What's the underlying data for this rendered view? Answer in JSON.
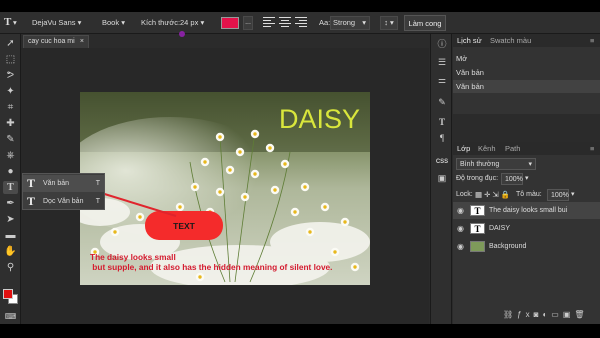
{
  "options_bar": {
    "font_family": "DejaVu Sans",
    "font_style": "Book",
    "size_label": "Kích thước:",
    "size_value": "24 px",
    "text_color": "#e3134b",
    "more": "...",
    "aa_label": "Aa:",
    "aa_value": "Strong",
    "commit_label": "Làm cong"
  },
  "document_tab": {
    "name": "cay cuc hoa mi",
    "close": "×"
  },
  "tool_menu": {
    "items": [
      {
        "label": "Văn bản",
        "key": "T",
        "selected": true
      },
      {
        "label": "Dọc Văn bản",
        "key": "T",
        "selected": false
      }
    ]
  },
  "canvas": {
    "title_text": "DAISY",
    "button_text": "TEXT",
    "caption_line1": "The daisy looks small",
    "caption_line2": " but supple, and it also has the hidden meaning of silent love."
  },
  "history_panel": {
    "tabs": [
      "Lịch sử",
      "Swatch màu"
    ],
    "rows": [
      "Mở",
      "Văn bản",
      "Văn bản"
    ]
  },
  "layers_panel": {
    "tabs": [
      "Lớp",
      "Kênh",
      "Path"
    ],
    "blend_mode": "Bình thường",
    "opacity_label": "Độ trong đục:",
    "opacity_value": "100%",
    "lock_label": "Lock:",
    "fill_label": "Tô màu:",
    "fill_value": "100%",
    "layers": [
      {
        "name": "The daisy looks small bui",
        "type": "text",
        "selected": true
      },
      {
        "name": "DAISY",
        "type": "text",
        "selected": false
      },
      {
        "name": "Background",
        "type": "image",
        "selected": false
      }
    ]
  },
  "colors": {
    "foreground": "#e01010",
    "background": "#ffffff",
    "title_yellow": "#d9e63c",
    "button_red": "#f42b2b",
    "caption_red": "#d41a2e",
    "annotation_arrow": "#e0252d"
  }
}
